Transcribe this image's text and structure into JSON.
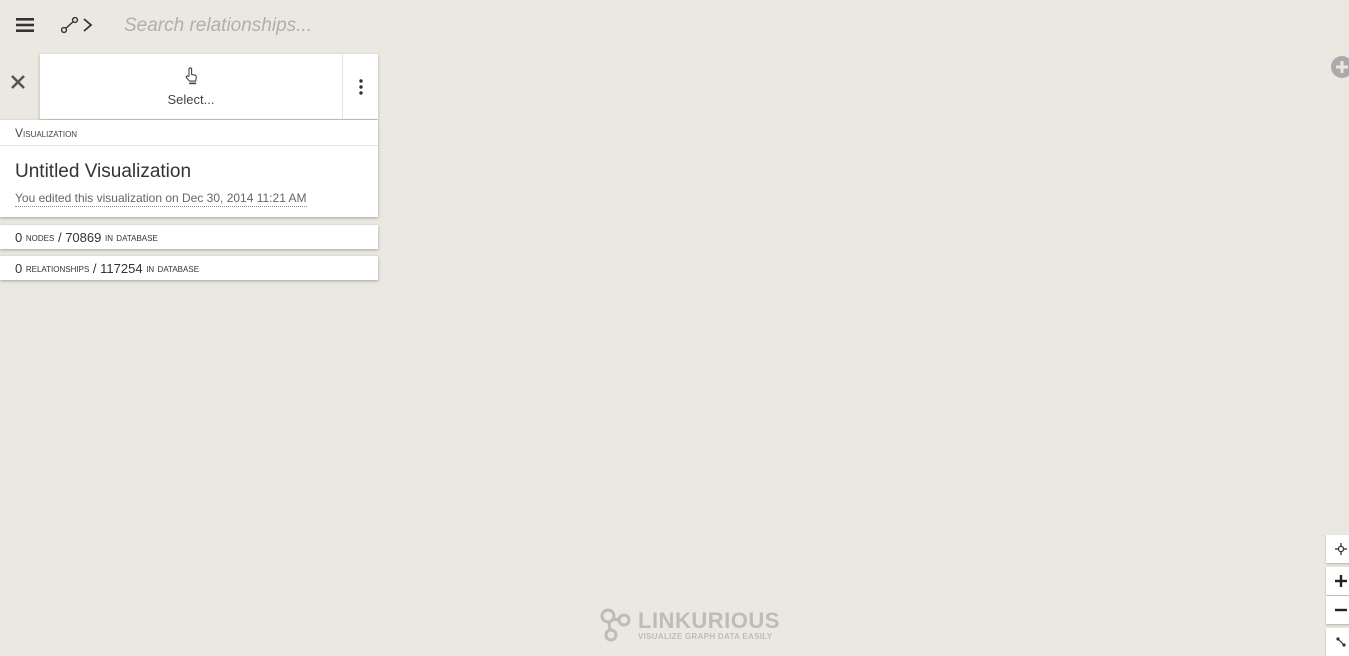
{
  "search": {
    "placeholder": "Search relationships..."
  },
  "select_panel": {
    "label": "Select..."
  },
  "visualization": {
    "header": "Visualization",
    "title": "Untitled Visualization",
    "edited_note": "You edited this visualization on Dec 30, 2014 11:21 AM"
  },
  "nodes": {
    "count": "0",
    "label": "nodes",
    "separator": "/",
    "total": "70869",
    "suffix": "in database"
  },
  "relationships": {
    "count": "0",
    "label": "relationships",
    "separator": "/",
    "total": "117254",
    "suffix": "in database"
  },
  "logo": {
    "name": "LINKURIOUS",
    "tagline": "VISUALIZE GRAPH DATA EASILY"
  },
  "icons": {
    "menu": "hamburger-icon",
    "relationships_mode": "relationship-icon",
    "close": "close-icon",
    "select": "pointer-hand-icon",
    "more": "kebab-icon",
    "add": "add-circle-icon",
    "locate": "locate-icon",
    "zoom_in": "plus-icon",
    "zoom_out": "minus-icon",
    "layout": "layout-icon"
  }
}
